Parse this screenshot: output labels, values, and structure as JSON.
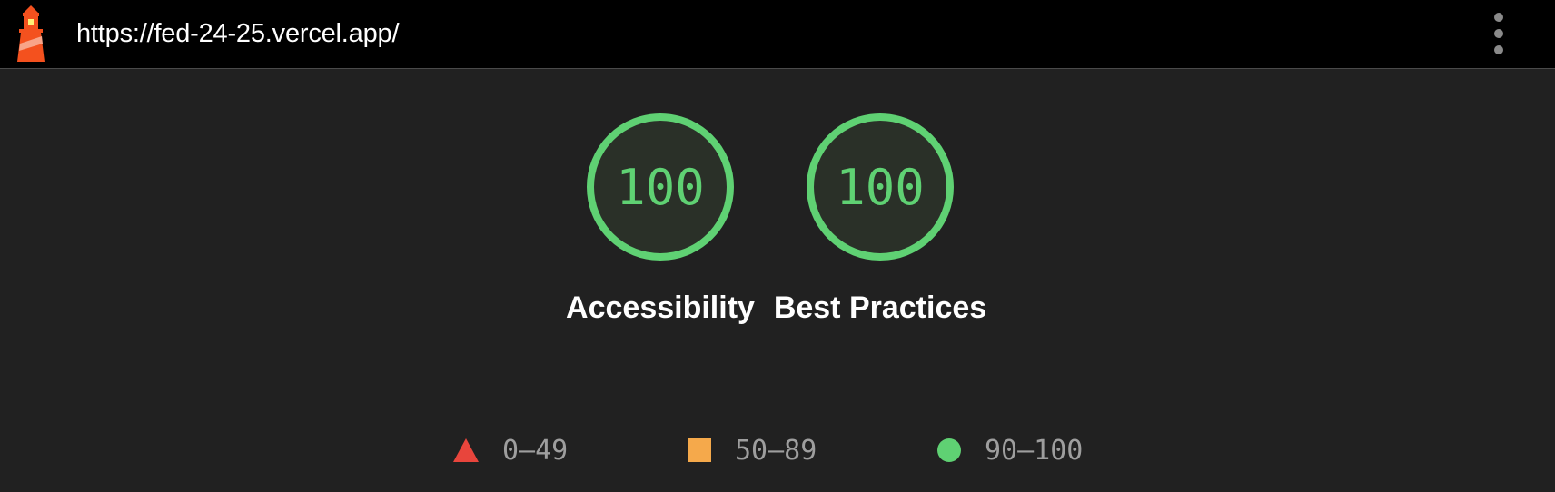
{
  "topbar": {
    "url": "https://fed-24-25.vercel.app/",
    "logo_icon": "lighthouse-logo-icon",
    "menu_icon": "vertical-dots-menu-icon"
  },
  "gauges": [
    {
      "score": "100",
      "value": 100,
      "label": "Accessibility"
    },
    {
      "score": "100",
      "value": 100,
      "label": "Best Practices"
    }
  ],
  "legend": [
    {
      "range": "0–49",
      "shape": "triangle",
      "color": "#e8453c"
    },
    {
      "range": "50–89",
      "shape": "square",
      "color": "#f5a94b"
    },
    {
      "range": "90–100",
      "shape": "circle",
      "color": "#5fd173"
    }
  ],
  "colors": {
    "pass": "#5fd173",
    "average": "#f5a94b",
    "fail": "#e8453c",
    "background": "#212121",
    "topbar": "#000000"
  }
}
